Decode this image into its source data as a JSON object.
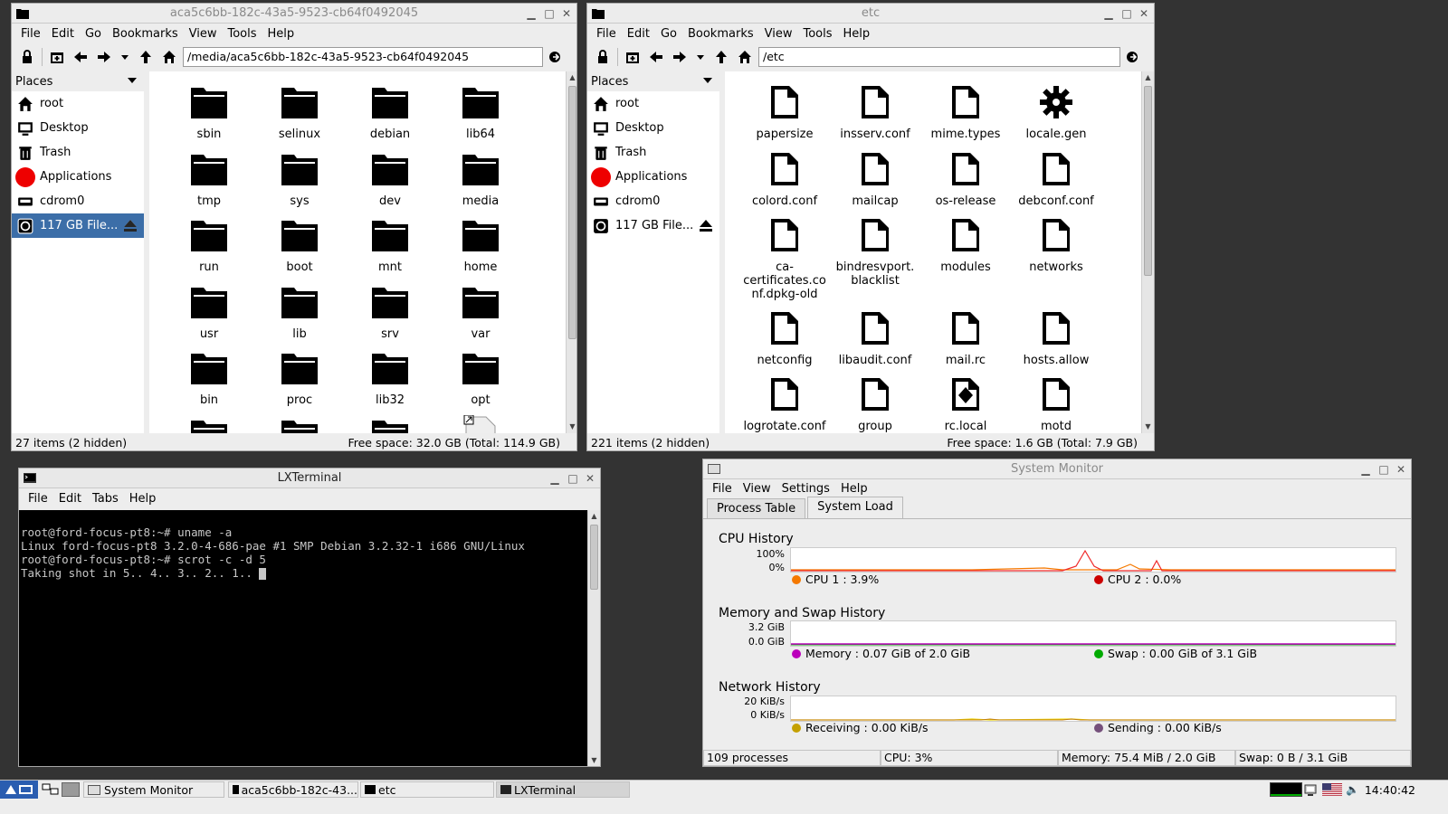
{
  "file_manager_media": {
    "title": "aca5c6bb-182c-43a5-9523-cb64f0492045",
    "menu": [
      "File",
      "Edit",
      "Go",
      "Bookmarks",
      "View",
      "Tools",
      "Help"
    ],
    "address": "/media/aca5c6bb-182c-43a5-9523-cb64f0492045",
    "places_label": "Places",
    "places": [
      "root",
      "Desktop",
      "Trash",
      "Applications",
      "cdrom0",
      "117 GB File..."
    ],
    "files": [
      "sbin",
      "selinux",
      "debian",
      "lib64",
      "tmp",
      "sys",
      "dev",
      "media",
      "run",
      "boot",
      "mnt",
      "home",
      "usr",
      "lib",
      "srv",
      "var",
      "bin",
      "proc",
      "lib32",
      "opt"
    ],
    "status_items": "27 items (2 hidden)",
    "status_free": "Free space: 32.0 GB (Total: 114.9 GB)"
  },
  "file_manager_etc": {
    "title": "etc",
    "menu": [
      "File",
      "Edit",
      "Go",
      "Bookmarks",
      "View",
      "Tools",
      "Help"
    ],
    "address": "/etc",
    "places_label": "Places",
    "places": [
      "root",
      "Desktop",
      "Trash",
      "Applications",
      "cdrom0",
      "117 GB File..."
    ],
    "files": [
      "papersize",
      "insserv.conf",
      "mime.types",
      "locale.gen",
      "colord.conf",
      "mailcap",
      "os-release",
      "debconf.conf",
      "ca-certificates.co nf.dpkg-old",
      "bindresvport. blacklist",
      "modules",
      "networks",
      "netconfig",
      "libaudit.conf",
      "mail.rc",
      "hosts.allow",
      "logrotate.conf",
      "group",
      "rc.local",
      "motd"
    ],
    "status_items": "221 items (2 hidden)",
    "status_free": "Free space: 1.6 GB (Total: 7.9 GB)"
  },
  "terminal": {
    "title": "LXTerminal",
    "menu": [
      "File",
      "Edit",
      "Tabs",
      "Help"
    ],
    "lines": [
      "root@ford-focus-pt8:~# uname -a",
      "Linux ford-focus-pt8 3.2.0-4-686-pae #1 SMP Debian 3.2.32-1 i686 GNU/Linux",
      "root@ford-focus-pt8:~# scrot -c -d 5",
      "Taking shot in 5.. 4.. 3.. 2.. 1.. "
    ]
  },
  "system_monitor": {
    "title": "System Monitor",
    "menu": [
      "File",
      "View",
      "Settings",
      "Help"
    ],
    "tabs": [
      "Process Table",
      "System Load"
    ],
    "cpu": {
      "heading": "CPU History",
      "y_max": "100%",
      "y_min": "0%",
      "cpu1": "CPU 1 : 3.9%",
      "cpu2": "CPU 2 : 0.0%",
      "cpu1_color": "#f57900",
      "cpu2_color": "#cc0000"
    },
    "memory": {
      "heading": "Memory and Swap History",
      "y_max": "3.2 GiB",
      "y_min": "0.0 GiB",
      "memory": "Memory : 0.07 GiB of 2.0 GiB",
      "swap": "Swap : 0.00 GiB of 3.1 GiB",
      "memory_color": "#bb00bb",
      "swap_color": "#00aa00"
    },
    "network": {
      "heading": "Network History",
      "y_max": "20 KiB/s",
      "y_min": "0 KiB/s",
      "receiving": "Receiving : 0.00 KiB/s",
      "sending": "Sending : 0.00 KiB/s",
      "receiving_color": "#c4a000",
      "sending_color": "#75507b"
    },
    "status": {
      "processes": "109 processes",
      "cpu": "CPU: 3%",
      "memory": "Memory: 75.4 MiB / 2.0 GiB",
      "swap": "Swap: 0 B / 3.1 GiB"
    }
  },
  "taskbar": {
    "tasks": [
      "System Monitor",
      "aca5c6bb-182c-43...",
      "etc",
      "LXTerminal"
    ],
    "clock": "14:40:42"
  }
}
